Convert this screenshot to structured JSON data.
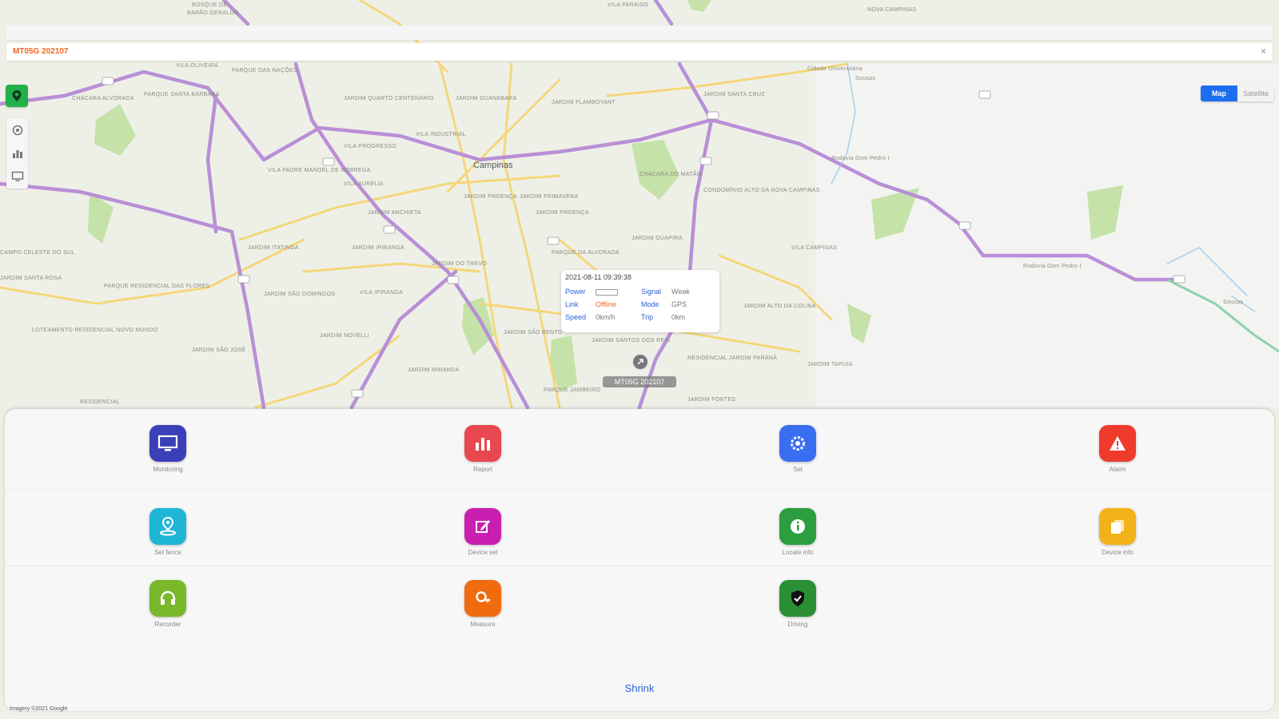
{
  "device_bar": {
    "name": "MT05G 202107",
    "close_icon": "close-icon"
  },
  "left_controls": {
    "locate_icon": "map-pin-icon",
    "tools": [
      "settings-icon",
      "chart-icon",
      "monitor-icon"
    ]
  },
  "map_type": {
    "map_label": "Map",
    "satellite_label": "Satellite"
  },
  "map": {
    "city": "Campinas"
  },
  "popup": {
    "time": "2021-08-11 09:39:38",
    "power_label": "Power",
    "signal_label": "Signal",
    "signal_value": "Weak",
    "link_label": "Link",
    "link_value": "Offline",
    "mode_label": "Mode",
    "mode_value": "GPS",
    "speed_label": "Speed",
    "speed_value": "0km/h",
    "trip_label": "Trip",
    "trip_value": "0km"
  },
  "marker_label": "MT05G 202107",
  "menu": {
    "items": [
      {
        "label": "Monitoring",
        "icon": "monitor-icon",
        "color": "#3b3fb8"
      },
      {
        "label": "Report",
        "icon": "bar-chart-icon",
        "color": "#e8474f"
      },
      {
        "label": "Set",
        "icon": "gear-icon",
        "color": "#3a6ef0"
      },
      {
        "label": "Alarm",
        "icon": "warning-icon",
        "color": "#ef3b2c"
      },
      {
        "label": "Set fence",
        "icon": "location-pin-icon",
        "color": "#1fb6d6"
      },
      {
        "label": "Device set",
        "icon": "edit-icon",
        "color": "#c81fb0"
      },
      {
        "label": "Locate info",
        "icon": "info-icon",
        "color": "#2d9e3f"
      },
      {
        "label": "Device info",
        "icon": "cards-icon",
        "color": "#f3b21a"
      },
      {
        "label": "Recorder",
        "icon": "headphones-icon",
        "color": "#78b82a"
      },
      {
        "label": "Measure",
        "icon": "search-key-icon",
        "color": "#f06a0e"
      },
      {
        "label": "Driving",
        "icon": "shield-check-icon",
        "color": "#2b8f35"
      }
    ],
    "shrink_label": "Shrink"
  },
  "bottom": {
    "legal": "Imagery ©2021 Google"
  }
}
